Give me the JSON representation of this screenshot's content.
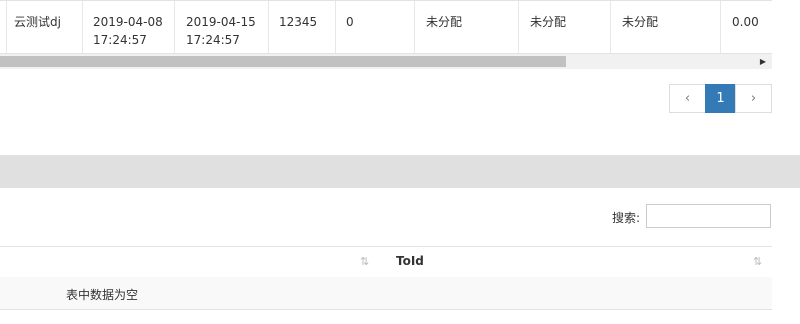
{
  "top_table": {
    "row": {
      "name": "云测试dj",
      "start_time": "2019-04-08\n17:24:57",
      "end_time": "2019-04-15\n17:24:57",
      "code": "12345",
      "count": "0",
      "status1": "未分配",
      "status2": "未分配",
      "status3": "未分配",
      "amount": "0.00"
    }
  },
  "pagination": {
    "prev_label": "‹",
    "current_page": "1",
    "next_label": "›"
  },
  "second_table": {
    "search_label": "搜索:",
    "search_value": "",
    "column_header": "ToId",
    "sort_icon": "⇅",
    "empty_message": "表中数据为空"
  },
  "colors": {
    "accent": "#337ab7",
    "band": "#e0e0e0",
    "scroll_thumb": "#c1c1c1"
  }
}
